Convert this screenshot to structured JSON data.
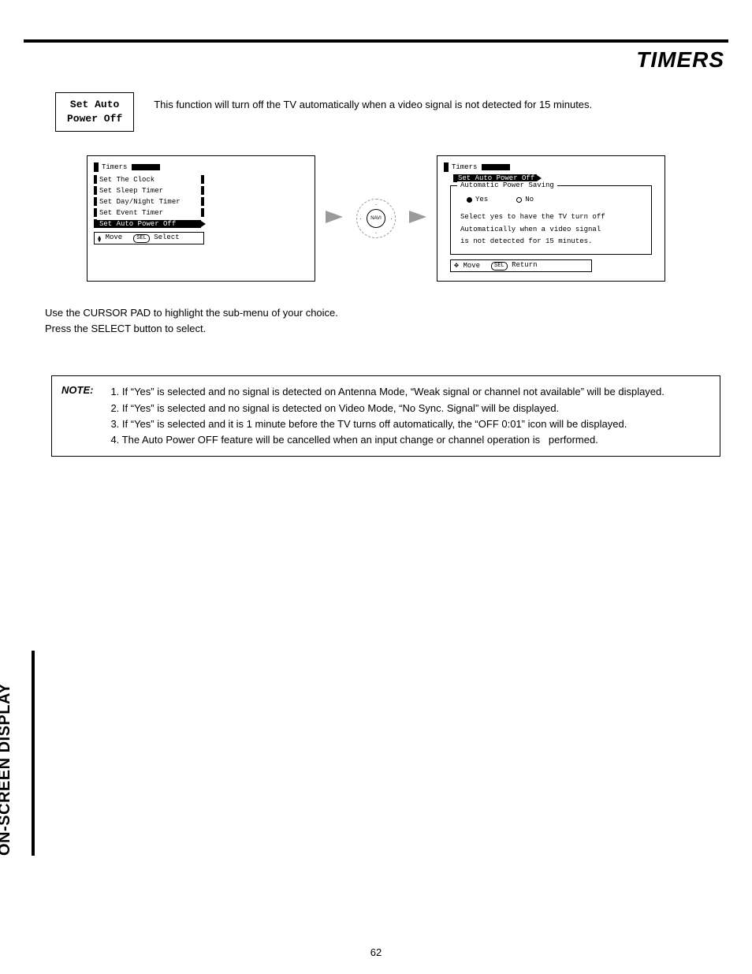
{
  "header": {
    "title": "TIMERS"
  },
  "label": {
    "line1": "Set Auto",
    "line2": "Power Off"
  },
  "intro": "This function will turn off the TV automatically when a video signal is not detected for 15 minutes.",
  "osd1": {
    "title": "Timers",
    "items": [
      "Set The Clock",
      "Set Sleep Timer",
      "Set Day/Night Timer",
      "Set Event Timer",
      "Set Auto Power Off"
    ],
    "highlight_index": 4,
    "footer": {
      "move": "Move",
      "action": "Select",
      "action_key": "SEL"
    }
  },
  "nav": {
    "center": "NAVI"
  },
  "osd2": {
    "title": "Timers",
    "submenu": "Set Auto Power Off",
    "group_label": "Automatic Power Saving",
    "options": {
      "yes": "Yes",
      "no": "No",
      "selected": "yes"
    },
    "help1": "Select yes to have the TV turn off",
    "help2": "Automatically when a video signal",
    "help3": "is not detected for 15 minutes.",
    "footer": {
      "move": "Move",
      "action": "Return",
      "action_key": "SEL"
    }
  },
  "instructions": {
    "l1": "Use the CURSOR PAD to highlight the sub-menu of your choice.",
    "l2": "Press the SELECT button to select."
  },
  "note": {
    "label": "NOTE:",
    "n1": "1. If “Yes” is selected and no signal is detected on Antenna Mode, “Weak signal or channel not available” will be displayed.",
    "n2": "2. If “Yes” is selected and no signal is detected on Video Mode, “No Sync. Signal” will be displayed.",
    "n3": "3. If “Yes” is selected and it is 1 minute before the TV turns off automatically, the “OFF 0:01” icon will be displayed.",
    "n4": "4. The Auto Power OFF feature will be cancelled when an input change or channel operation is   performed."
  },
  "side_tab": "ON-SCREEN DISPLAY",
  "page_number": "62"
}
